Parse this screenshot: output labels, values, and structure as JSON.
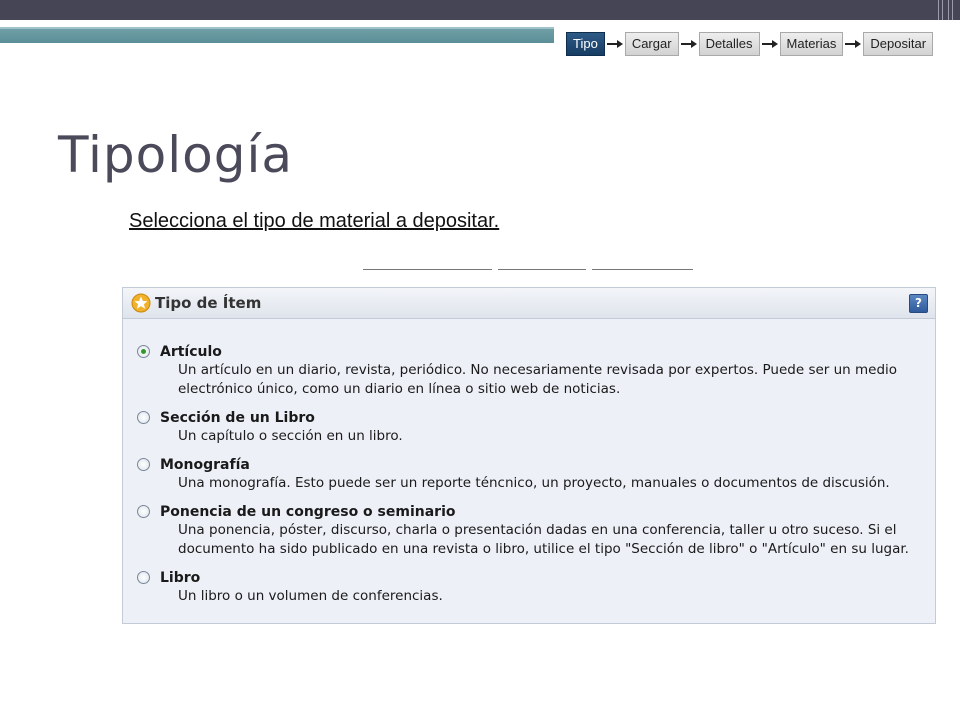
{
  "steps": [
    {
      "label": "Tipo",
      "active": true
    },
    {
      "label": "Cargar",
      "active": false
    },
    {
      "label": "Detalles",
      "active": false
    },
    {
      "label": "Materias",
      "active": false
    },
    {
      "label": "Depositar",
      "active": false
    }
  ],
  "page_title": "Tipología",
  "instruction": "Selecciona el tipo de  material a depositar.",
  "panel": {
    "title": "Tipo de Ítem",
    "help_glyph": "?",
    "header_icon": "star-icon",
    "help_icon": "help-icon"
  },
  "options": [
    {
      "label": "Artículo",
      "description": "Un artículo en un diario, revista, periódico. No necesariamente revisada por expertos. Puede ser un medio electrónico único, como un diario en línea o sitio web de noticias.",
      "selected": true
    },
    {
      "label": "Sección de un Libro",
      "description": "Un capítulo o sección en un libro.",
      "selected": false
    },
    {
      "label": "Monografía",
      "description": "Una monografía. Esto puede ser un reporte téncnico, un proyecto, manuales o documentos de discusión.",
      "selected": false
    },
    {
      "label": "Ponencia de un congreso o seminario",
      "description": "Una ponencia, póster, discurso, charla o presentación dadas en una conferencia, taller u otro suceso. Si el documento ha sido publicado en una revista o libro, utilice el tipo \"Sección de libro\" o \"Artículo\" en su lugar.",
      "selected": false
    },
    {
      "label": "Libro",
      "description": "Un libro o un volumen de conferencias.",
      "selected": false
    }
  ],
  "colors": {
    "title": "#4a4a5a",
    "top_bar": "#454556",
    "teal_bar": "#5b8f98",
    "active_step": "#1f4a73",
    "panel_bg": "#eef0f8",
    "radio_selected": "#2f9a2a"
  }
}
